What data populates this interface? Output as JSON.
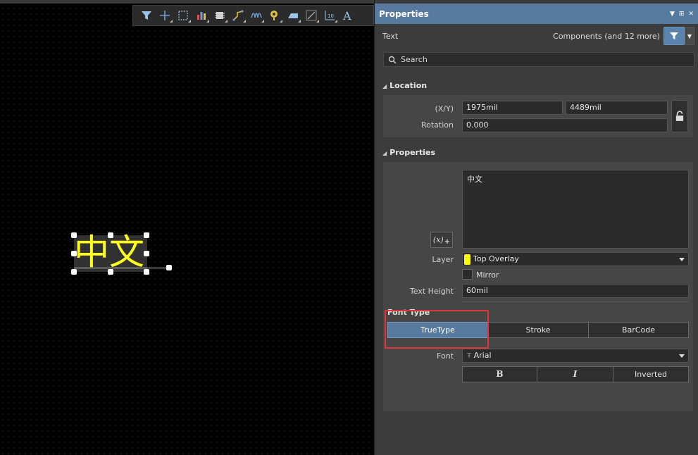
{
  "toolbar": {
    "icons": [
      "filter-icon",
      "cross-select-icon",
      "rect-select-icon",
      "chart-icon",
      "chip-icon",
      "route-icon",
      "wave-icon",
      "pin-icon",
      "board-icon",
      "line-icon",
      "label-icon",
      "text-icon"
    ]
  },
  "canvas": {
    "text_object": "中文",
    "text_color": "#ffff1e"
  },
  "panel": {
    "title": "Properties",
    "object_kind": "Text",
    "filter_summary": "Components (and 12 more)",
    "search_placeholder": "Search",
    "location": {
      "title": "Location",
      "xy_label": "(X/Y)",
      "x": "1975mil",
      "y": "4489mil",
      "rotation_label": "Rotation",
      "rotation": "0.000"
    },
    "properties": {
      "title": "Properties",
      "text": "中文",
      "fx_label": "(x)",
      "layer_label": "Layer",
      "layer": "Top Overlay",
      "layer_color": "#ffff00",
      "mirror_label": "Mirror",
      "text_height_label": "Text Height",
      "text_height": "60mil",
      "font_type_label": "Font Type",
      "font_types": [
        "TrueType",
        "Stroke",
        "BarCode"
      ],
      "font_label": "Font",
      "font": "Arial",
      "bold_label": "B",
      "italic_label": "I",
      "inverted_label": "Inverted"
    }
  }
}
